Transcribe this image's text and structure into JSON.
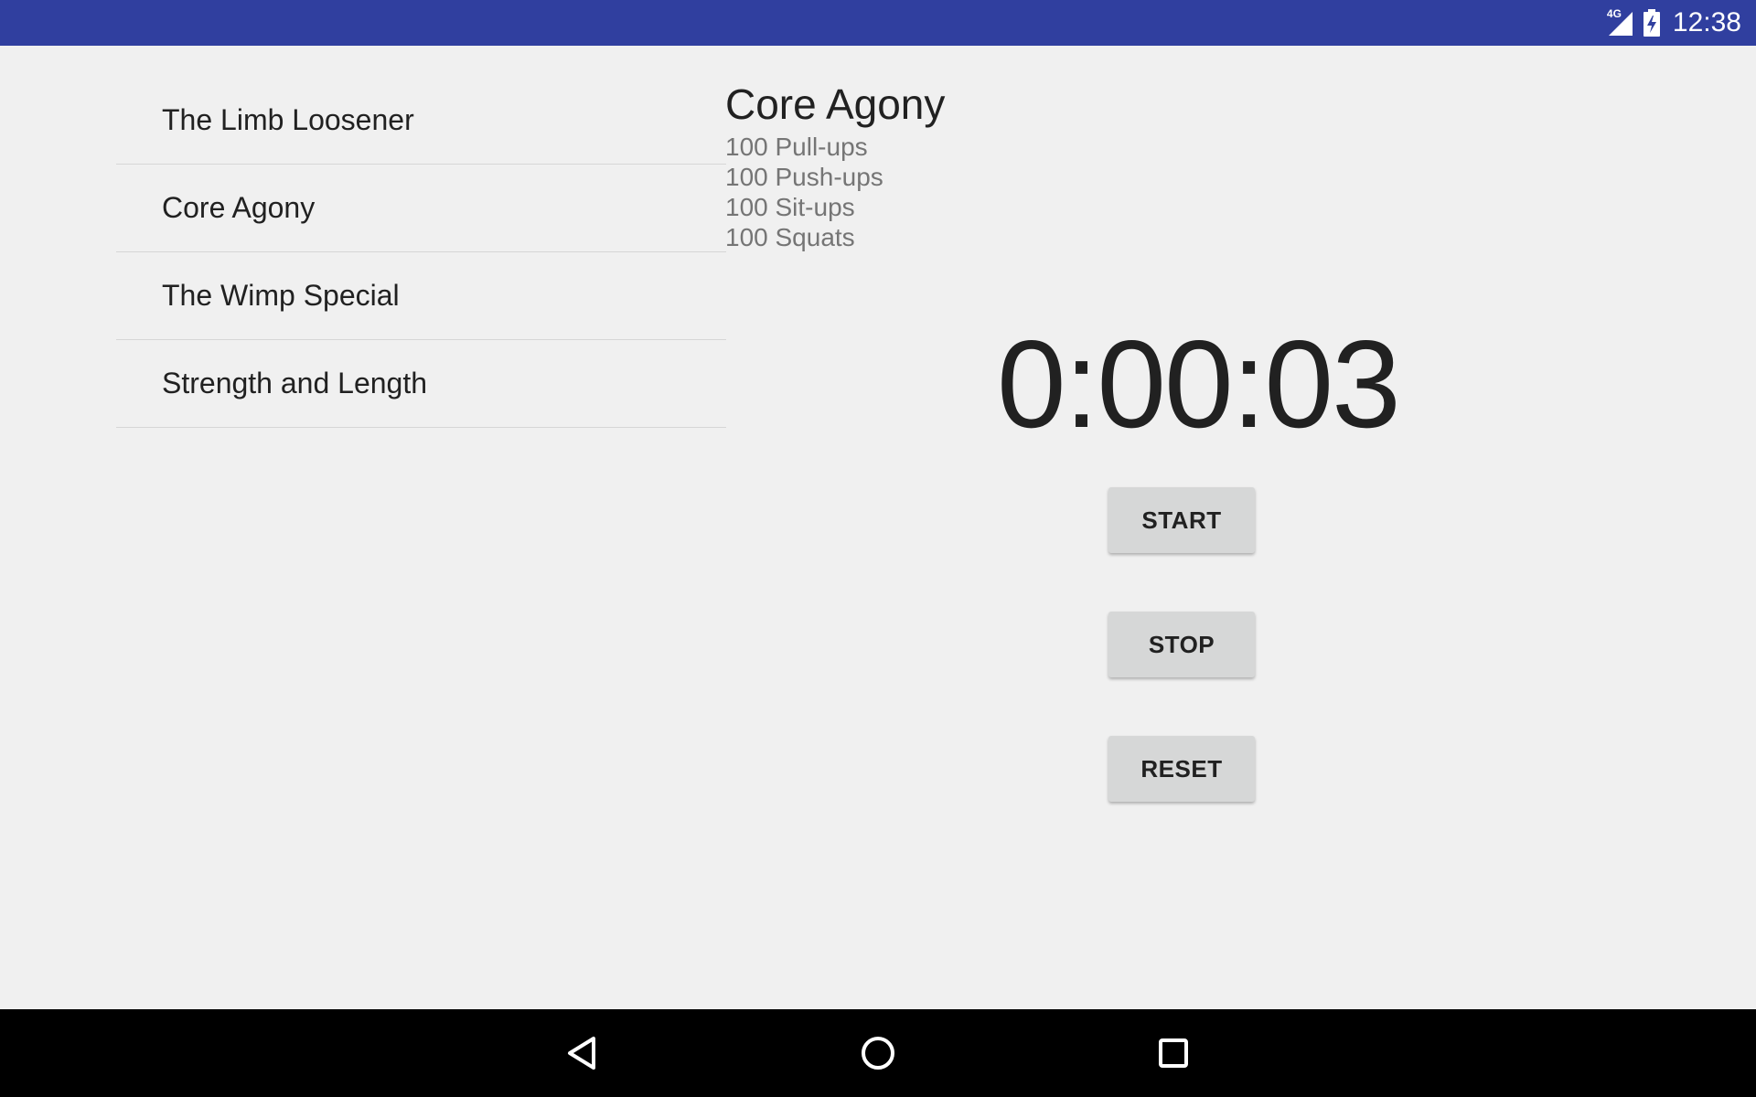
{
  "status_bar": {
    "network": "4G",
    "time": "12:38",
    "icons": [
      "signal-icon",
      "battery-charging-icon"
    ]
  },
  "workouts": [
    {
      "label": "The Limb Loosener"
    },
    {
      "label": "Core Agony"
    },
    {
      "label": "The Wimp Special"
    },
    {
      "label": "Strength and Length"
    }
  ],
  "detail": {
    "title": "Core Agony",
    "exercises": [
      "100 Pull-ups",
      "100 Push-ups",
      "100 Sit-ups",
      "100 Squats"
    ]
  },
  "stopwatch": {
    "time": "0:00:03"
  },
  "buttons": {
    "start": "START",
    "stop": "STOP",
    "reset": "RESET"
  },
  "nav_bar": {
    "icons": [
      "back-icon",
      "home-icon",
      "recent-apps-icon"
    ]
  },
  "colors": {
    "status_bar": "#303f9f",
    "background": "#f0f0f0",
    "button": "#d6d7d7",
    "nav_bar": "#000000"
  }
}
